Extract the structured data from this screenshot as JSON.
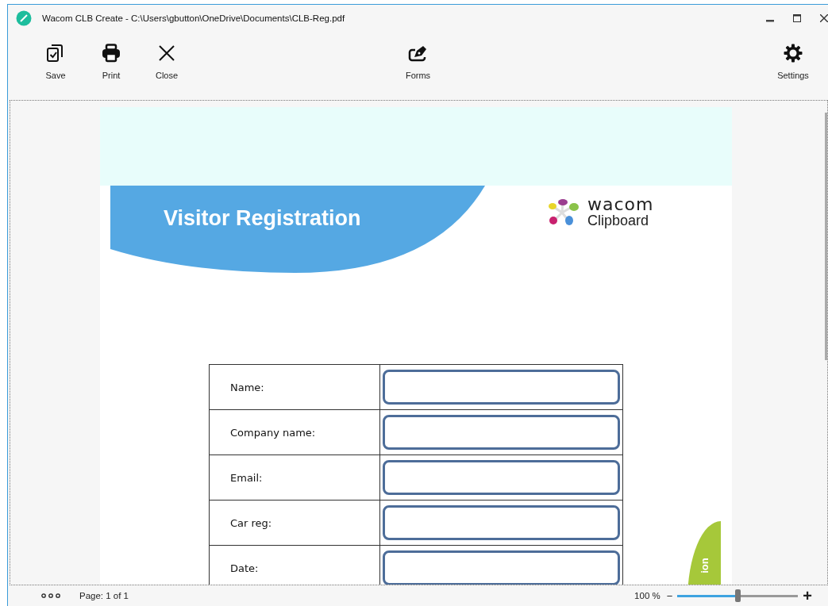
{
  "window": {
    "title": "Wacom CLB Create - C:\\Users\\gbutton\\OneDrive\\Documents\\CLB-Reg.pdf"
  },
  "toolbar": {
    "left": [
      {
        "label": "Save",
        "kind": "save"
      },
      {
        "label": "Print",
        "kind": "print"
      },
      {
        "label": "Close",
        "kind": "close"
      }
    ],
    "center": [
      {
        "label": "Forms",
        "kind": "forms"
      }
    ],
    "right": [
      {
        "label": "Settings",
        "kind": "settings"
      }
    ]
  },
  "document": {
    "heading": "Visitor Registration",
    "logo": {
      "wordmark": "wacom",
      "product": "Clipboard"
    },
    "fields": [
      {
        "label": "Name:"
      },
      {
        "label": "Company name:"
      },
      {
        "label": "Email:"
      },
      {
        "label": "Car reg:"
      },
      {
        "label": "Date:"
      }
    ],
    "side_text": "ion"
  },
  "status_bar": {
    "page": "Page: 1 of 1",
    "zoom": "100 %",
    "zoom_out": "−",
    "zoom_in": "+",
    "level": 0.5
  }
}
